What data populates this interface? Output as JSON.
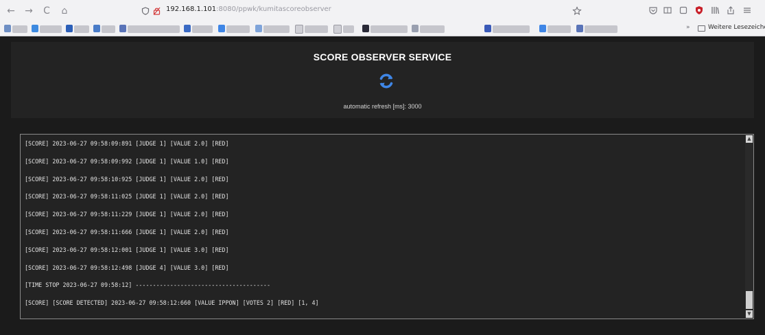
{
  "browser": {
    "url_host": "192.168.1.101",
    "url_path": ":8080/ppwk/kumitascoreobserver",
    "bookmarks_overflow": "»",
    "other_bookmarks_label": "Weitere Lesezeichen",
    "nav_icons": {
      "back": "←",
      "forward": "→",
      "reload": "C",
      "home": "⌂"
    }
  },
  "page": {
    "title": "SCORE OBSERVER SERVICE",
    "refresh_label": "automatic refresh [ms]: 3000",
    "accent_color": "#3f86e6",
    "background_color": "#1b1b1b"
  },
  "log": {
    "lines": [
      "[SCORE] 2023-06-27 09:58:09:891 [JUDGE 1] [VALUE 2.0] [RED]",
      "[SCORE] 2023-06-27 09:58:09:992 [JUDGE 1] [VALUE 1.0] [RED]",
      "[SCORE] 2023-06-27 09:58:10:925 [JUDGE 1] [VALUE 2.0] [RED]",
      "[SCORE] 2023-06-27 09:58:11:025 [JUDGE 1] [VALUE 2.0] [RED]",
      "[SCORE] 2023-06-27 09:58:11:229 [JUDGE 1] [VALUE 2.0] [RED]",
      "[SCORE] 2023-06-27 09:58:11:666 [JUDGE 1] [VALUE 2.0] [RED]",
      "[SCORE] 2023-06-27 09:58:12:001 [JUDGE 1] [VALUE 3.0] [RED]",
      "[SCORE] 2023-06-27 09:58:12:498 [JUDGE 4] [VALUE 3.0] [RED]",
      "[TIME STOP 2023-06-27 09:58:12] ---------------------------------------",
      "[SCORE] [SCORE DETECTED] 2023-06-27 09:58:12:660 [VALUE IPPON] [VOTES 2] [RED] [1, 4]"
    ]
  }
}
